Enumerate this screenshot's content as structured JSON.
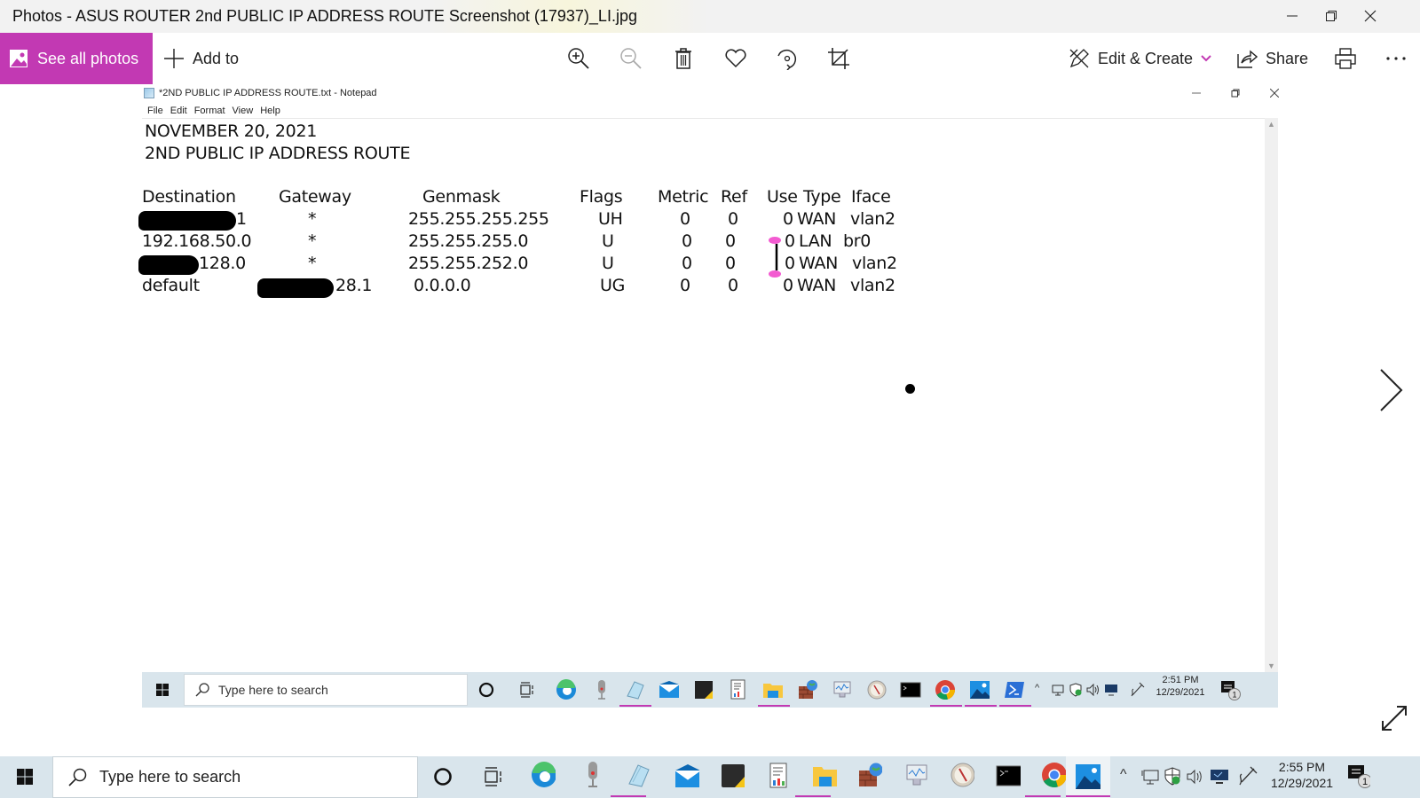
{
  "window": {
    "title": "Photos - ASUS ROUTER 2nd PUBLIC IP ADDRESS ROUTE Screenshot (17937)_LI.jpg",
    "controls": [
      "minimize",
      "restore",
      "close"
    ]
  },
  "toolbar": {
    "see_all_photos": "See all photos",
    "add_to": "Add to",
    "icons": [
      "zoom-in",
      "zoom-out",
      "delete",
      "favorite",
      "rotate",
      "crop"
    ],
    "edit_create": "Edit & Create",
    "share": "Share",
    "print_icon": "print",
    "more_icon": "more"
  },
  "notepad": {
    "title": "*2ND PUBLIC IP ADDRESS ROUTE.txt - Notepad",
    "menu": [
      "File",
      "Edit",
      "Format",
      "View",
      "Help"
    ],
    "lines": {
      "date": "NOVEMBER 20, 2021",
      "heading": "2ND PUBLIC IP ADDRESS ROUTE"
    },
    "table": {
      "headers": [
        "Destination",
        "Gateway",
        "Genmask",
        "Flags",
        "Metric",
        "Ref",
        "Use",
        "Type",
        "Iface"
      ],
      "rows": [
        {
          "destination": "1",
          "destination_redacted": true,
          "gateway": "*",
          "genmask": "255.255.255.255",
          "flags": "UH",
          "metric": "0",
          "ref": "0",
          "use": "0",
          "type": "WAN",
          "iface": "vlan2"
        },
        {
          "destination": "192.168.50.0",
          "destination_redacted": false,
          "gateway": "*",
          "genmask": "255.255.255.0",
          "flags": "U",
          "metric": "0",
          "ref": "0",
          "use": "0",
          "type": "LAN",
          "iface": "br0"
        },
        {
          "destination": "128.0",
          "destination_redacted": true,
          "gateway": "*",
          "genmask": "255.255.252.0",
          "flags": "U",
          "metric": "0",
          "ref": "0",
          "use": "0",
          "type": "WAN",
          "iface": "vlan2"
        },
        {
          "destination": "default",
          "destination_redacted": false,
          "gateway": "28.1",
          "gateway_redacted": true,
          "genmask": "0.0.0.0",
          "flags": "UG",
          "metric": "0",
          "ref": "0",
          "use": "0",
          "type": "WAN",
          "iface": "vlan2"
        }
      ]
    },
    "inner_taskbar": {
      "search_placeholder": "Type here to search",
      "time": "2:51 PM",
      "date": "12/29/2021",
      "notification_count": "1"
    }
  },
  "taskbar": {
    "search_placeholder": "Type here to search",
    "apps": [
      "cortana",
      "task-view",
      "edge",
      "voice-recorder",
      "notepad",
      "mail",
      "sticky-notes",
      "report",
      "file-explorer",
      "firewall",
      "resource-monitor",
      "clock-app",
      "command-prompt",
      "chrome",
      "photos"
    ],
    "time": "2:55 PM",
    "date": "12/29/2021",
    "notification_count": "1"
  },
  "colors": {
    "accent": "#c239b3",
    "taskbar": "#d9e5ec"
  }
}
